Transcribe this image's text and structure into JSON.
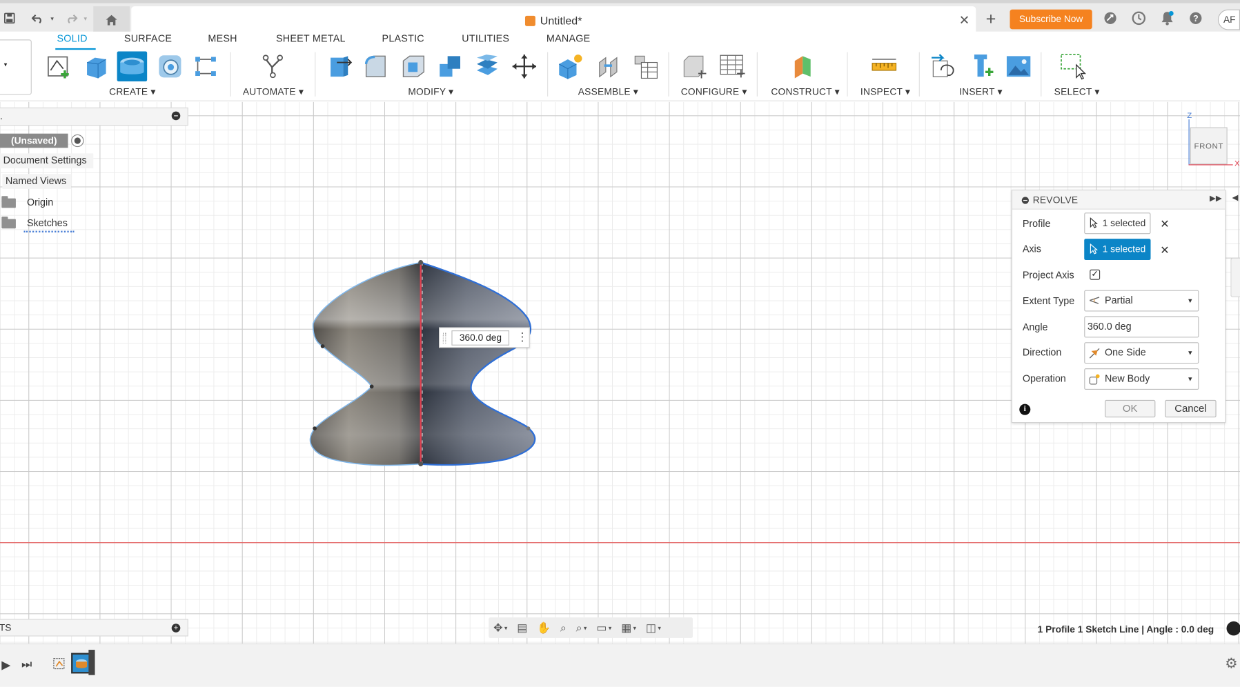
{
  "title_bar": {
    "doc_title": "Untitled*",
    "subscribe_label": "Subscribe Now",
    "user_initials": "AF"
  },
  "ribbon": {
    "tabs": [
      {
        "label": "SOLID",
        "active": true
      },
      {
        "label": "SURFACE"
      },
      {
        "label": "MESH"
      },
      {
        "label": "SHEET METAL"
      },
      {
        "label": "PLASTIC"
      },
      {
        "label": "UTILITIES"
      },
      {
        "label": "MANAGE"
      }
    ],
    "groups": {
      "create": "CREATE ▾",
      "automate": "AUTOMATE ▾",
      "modify": "MODIFY ▾",
      "assemble": "ASSEMBLE ▾",
      "configure": "CONFIGURE ▾",
      "construct": "CONSTRUCT ▾",
      "inspect": "INSPECT ▾",
      "insert": "INSERT ▾",
      "select": "SELECT ▾"
    }
  },
  "browser": {
    "root_label": "(Unsaved)",
    "items": [
      "Document Settings",
      "Named Views",
      "Origin",
      "Sketches"
    ]
  },
  "comments": {
    "label": "TS"
  },
  "viewport": {
    "angle_value": "360.0 deg",
    "view_cube_label": "FRONT",
    "axis_labels": {
      "z": "Z",
      "x": "X"
    }
  },
  "revolve_dialog": {
    "title": "REVOLVE",
    "profile_label": "Profile",
    "profile_value": "1 selected",
    "axis_label": "Axis",
    "axis_value": "1 selected",
    "project_axis_label": "Project Axis",
    "project_axis_checked": "✓",
    "extent_type_label": "Extent Type",
    "extent_type_value": "Partial",
    "angle_label": "Angle",
    "angle_value": "360.0 deg",
    "direction_label": "Direction",
    "direction_value": "One Side",
    "operation_label": "Operation",
    "operation_value": "New Body",
    "ok_label": "OK",
    "cancel_label": "Cancel",
    "info_glyph": "i"
  },
  "status_bar": {
    "text": "1 Profile 1 Sketch Line | Angle : 0.0 deg"
  },
  "colors": {
    "accent": "#0696d7",
    "selected_button": "#0b85c7",
    "subscribe": "#f5821f",
    "x_axis": "#e85a5a",
    "profile_outline": "#2f6fd6"
  }
}
